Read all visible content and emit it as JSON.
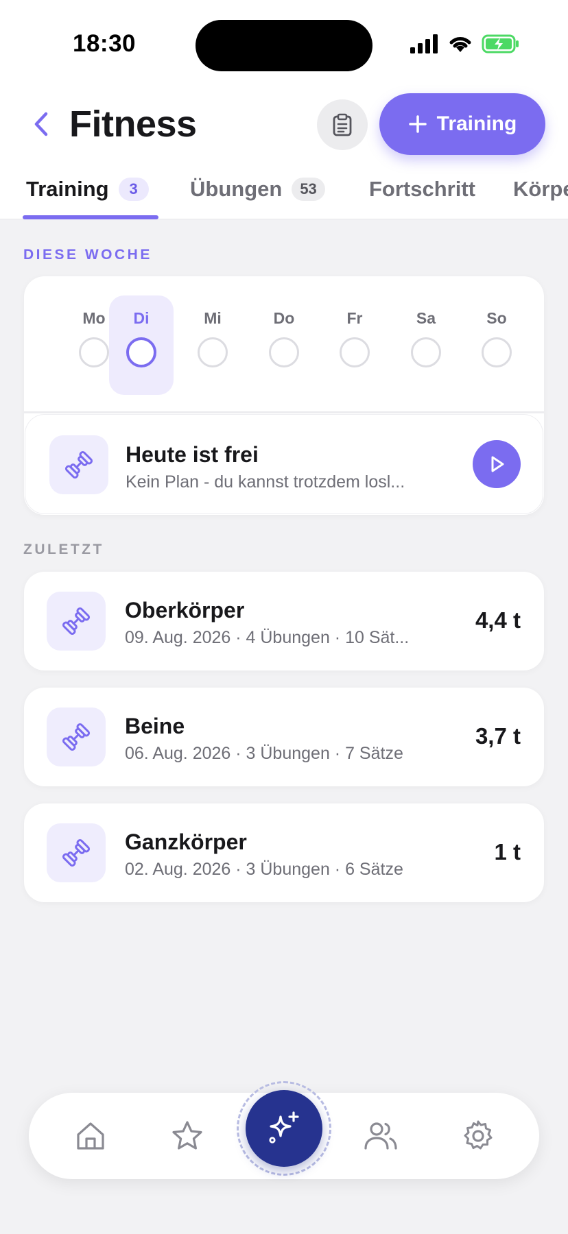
{
  "status_bar": {
    "time": "18:30",
    "icons": [
      "signal-icon",
      "wifi-icon",
      "battery-charging-icon"
    ]
  },
  "header": {
    "title": "Fitness",
    "back_icon": "chevron-left-icon",
    "clipboard_icon": "clipboard-icon",
    "add_button_label": "Training",
    "add_button_icon": "plus-icon"
  },
  "tabs": [
    {
      "label": "Training",
      "badge": "3",
      "active": true
    },
    {
      "label": "Übungen",
      "badge": "53",
      "active": false
    },
    {
      "label": "Fortschritt",
      "badge": "",
      "active": false
    },
    {
      "label": "Körpe",
      "badge": "",
      "active": false
    }
  ],
  "week": {
    "section_label": "DIESE WOCHE",
    "days": [
      "Mo",
      "Di",
      "Mi",
      "Do",
      "Fr",
      "Sa",
      "So"
    ],
    "selected_day": "Di",
    "today": {
      "title": "Heute ist frei",
      "subtitle": "Kein Plan - du kannst trotzdem losl...",
      "icon": "dumbbell-icon",
      "action_icon": "play-icon"
    }
  },
  "recent": {
    "section_label": "ZULETZT",
    "items": [
      {
        "title": "Oberkörper",
        "subtitle": "09. Aug. 2026 · 4 Übungen · 10 Sät...",
        "value": "4,4 t"
      },
      {
        "title": "Beine",
        "subtitle": "06. Aug. 2026 · 3 Übungen · 7 Sätze",
        "value": "3,7 t"
      },
      {
        "title": "Ganzkörper",
        "subtitle": "02. Aug. 2026 · 3 Übungen · 6 Sätze",
        "value": "1 t"
      }
    ]
  },
  "bottom_nav": {
    "items": [
      "home-icon",
      "star-icon",
      "sparkles-icon",
      "users-icon",
      "settings-icon"
    ],
    "active": "sparkles-icon"
  },
  "colors": {
    "accent": "#7b6cf0",
    "accent_light": "#efedfd",
    "fab": "#26338f",
    "background": "#f2f2f4"
  }
}
